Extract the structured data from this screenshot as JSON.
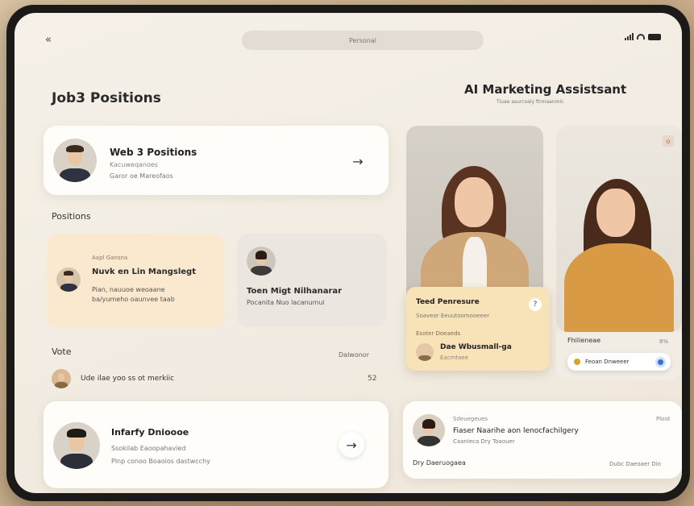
{
  "status": {
    "url": "Personal"
  },
  "left": {
    "title": "Job3 Positions",
    "featured": {
      "title": "Web 3 Positions",
      "subtitle": "Kacuweqanoes",
      "meta": "Garor oe Mareofaos"
    },
    "positions_label": "Positions",
    "position_cards": [
      {
        "small": "Aapl Gansna",
        "title": "Nuvk en Lin Mangslegt",
        "desc1": "Pian, nauuoe weoaane",
        "desc2": "ba/yumeho oaunvee taab",
        "bg": "#fbe9cf"
      },
      {
        "title": "Toen Migt Nilhanarar",
        "desc1": "Pocanita Nuo lacanumui",
        "bg": "#ebe6df"
      }
    ],
    "vote_label": "Vote",
    "vote_right": "Dalwonor",
    "vote_row": {
      "text": "Ude ilae yoo ss ot merkiic",
      "count": "52"
    },
    "bottom_card": {
      "title": "Infarfy Dnioooe",
      "subtitle": "Ssokilab Eaoopahavied",
      "meta": "Plnp conoo Boaoios dastwcchy"
    }
  },
  "right": {
    "title": "AI Marketing Assistsant",
    "subtitle": "Tiuae asurcoaly ftrmaanmic",
    "card_top_icon": "o",
    "info_card": {
      "title": "Teed Penresure",
      "subtitle": "Soaveor Eeuutoomooeeer",
      "small": "Esoter  Doeaeds",
      "name": "Dae Wbusmall-ga",
      "role": "Eacmtaee"
    },
    "side_panel": {
      "label": "Fhilieneae",
      "pct": "8%",
      "toggle": "Feoan Dnweeer"
    },
    "bottom": {
      "small_left": "Sdeuegeues",
      "small_right": "Ploot",
      "title": "Fiaser Naarihe aon lenocfachilgery",
      "subtitle": "Caanieca Dry Toaouer",
      "footer_left": "Dry Daeruogaea",
      "footer_right": "Dubc Daeoaer Dio"
    }
  },
  "colors": {
    "accent": "#3a6fd8",
    "highlight": "#fbe9cf",
    "warm_card": "#f8e3b8"
  }
}
